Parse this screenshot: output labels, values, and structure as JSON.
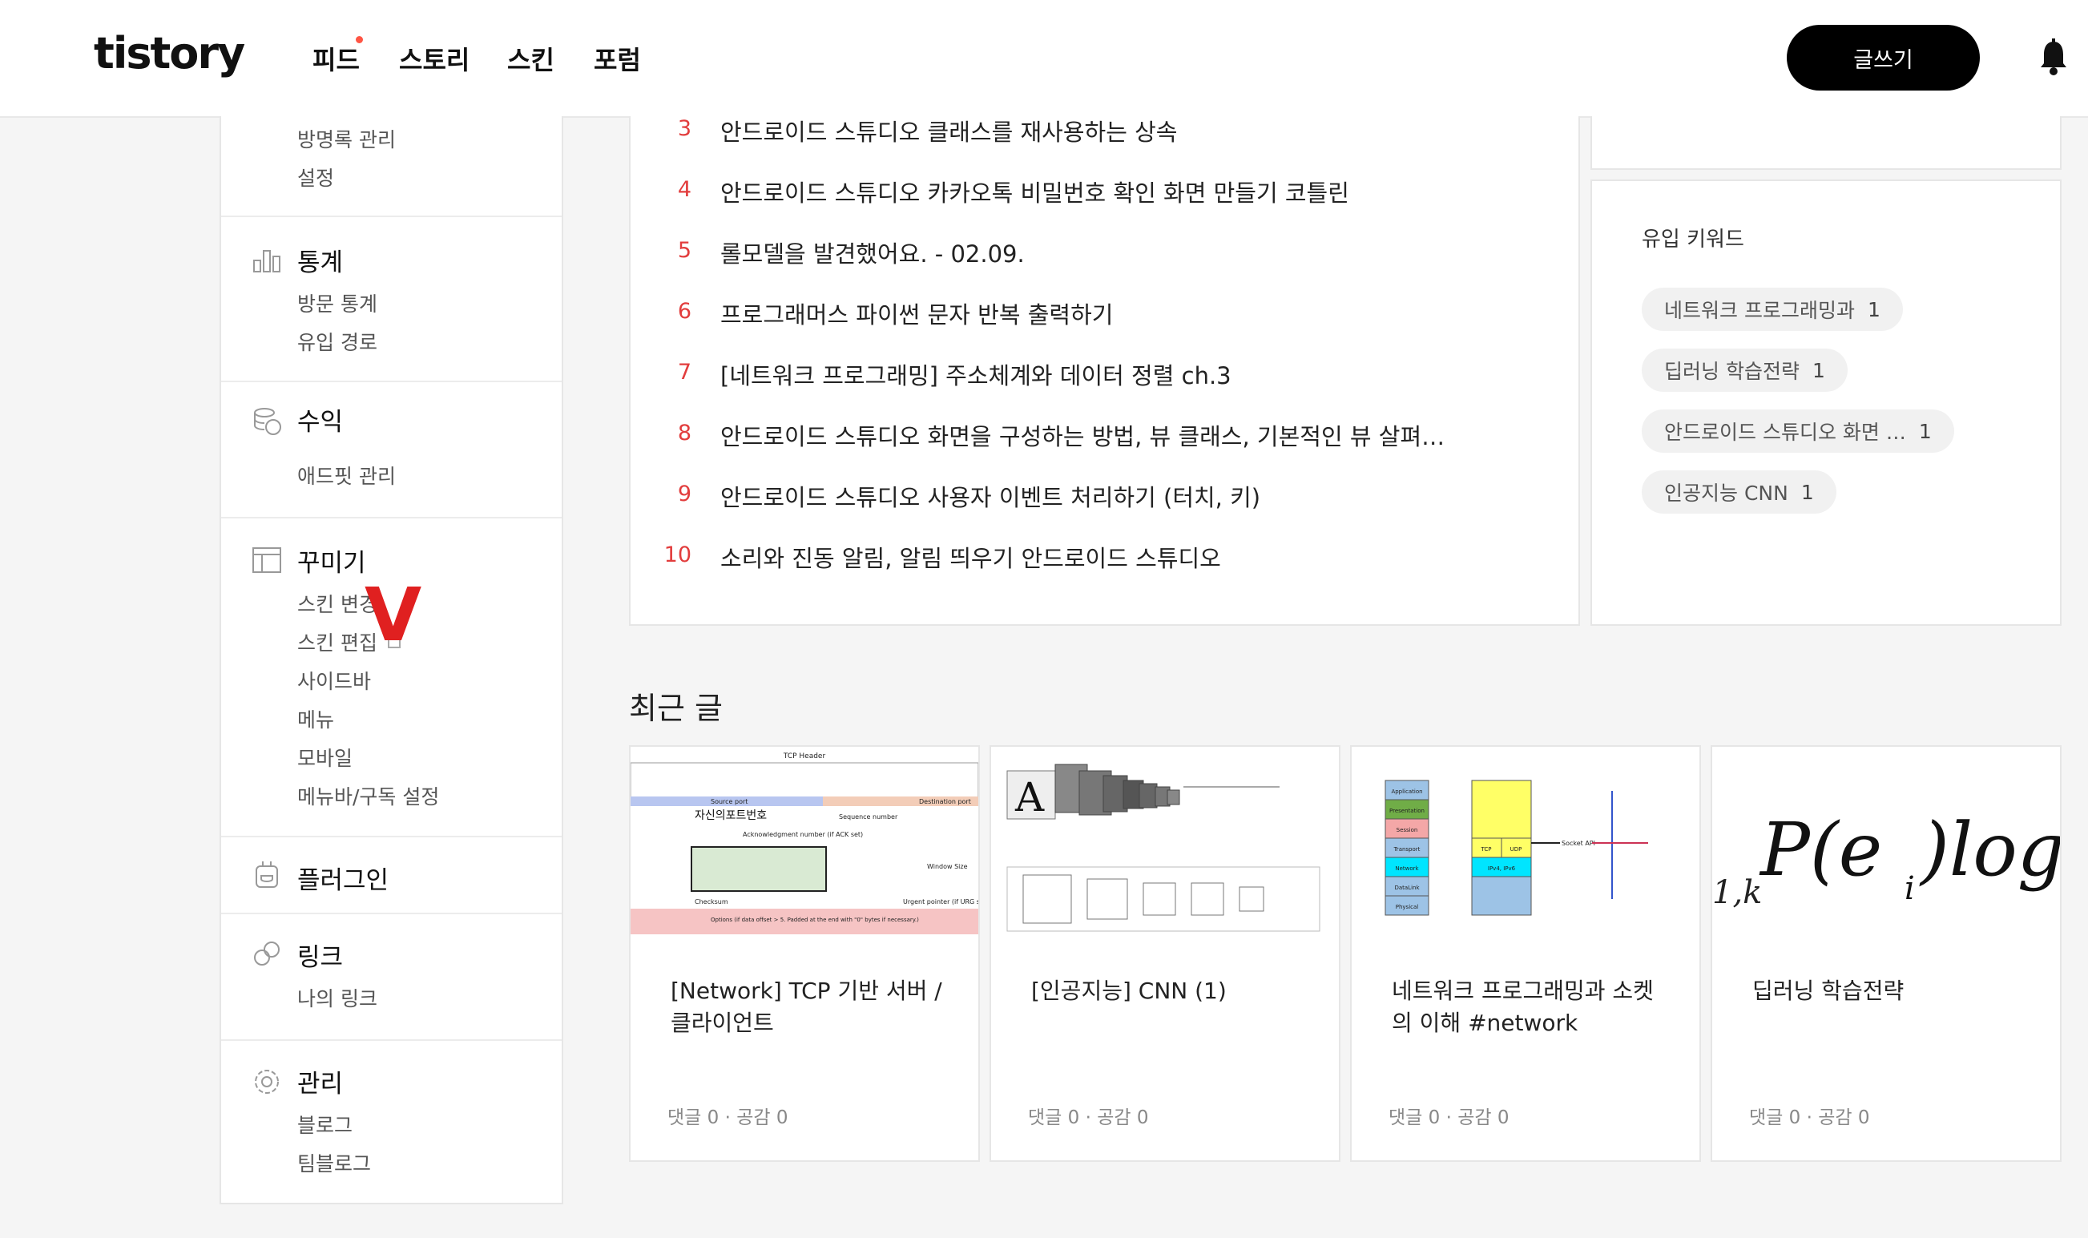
{
  "header": {
    "logo": "tistory",
    "nav": [
      "피드",
      "스토리",
      "스킨",
      "포럼"
    ],
    "write_label": "글쓰기"
  },
  "sidebar": {
    "top_items": [
      "방명록 관리",
      "설정"
    ],
    "sections": [
      {
        "title": "통계",
        "icon": "bar-chart-icon",
        "items": [
          "방문 통계",
          "유입 경로"
        ]
      },
      {
        "title": "수익",
        "icon": "coins-icon",
        "items": [
          "애드핏 관리"
        ]
      },
      {
        "title": "꾸미기",
        "icon": "layout-icon",
        "items": [
          "스킨 변경",
          "스킨 편집",
          "사이드바",
          "메뉴",
          "모바일",
          "메뉴바/구독 설정"
        ]
      },
      {
        "title": "플러그인",
        "icon": "plug-icon",
        "items": []
      },
      {
        "title": "링크",
        "icon": "link-icon",
        "items": [
          "나의 링크"
        ]
      },
      {
        "title": "관리",
        "icon": "gear-icon",
        "items": [
          "블로그",
          "팀블로그"
        ]
      }
    ],
    "annotation_mark": "V"
  },
  "popular": {
    "items": [
      {
        "rank": "3",
        "title": "안드로이드 스튜디오 클래스를 재사용하는 상속"
      },
      {
        "rank": "4",
        "title": "안드로이드 스튜디오 카카오톡 비밀번호 확인 화면 만들기 코틀린"
      },
      {
        "rank": "5",
        "title": "롤모델을 발견했어요. - 02.09."
      },
      {
        "rank": "6",
        "title": "프로그래머스 파이썬 문자 반복 출력하기"
      },
      {
        "rank": "7",
        "title": "[네트워크 프로그래밍] 주소체계와 데이터 정렬 ch.3"
      },
      {
        "rank": "8",
        "title": "안드로이드 스튜디오 화면을 구성하는 방법, 뷰 클래스, 기본적인 뷰 살펴…"
      },
      {
        "rank": "9",
        "title": "안드로이드 스튜디오 사용자 이벤트 처리하기 (터치, 키)"
      },
      {
        "rank": "10",
        "title": "소리와 진동 알림, 알림 띄우기 안드로이드 스튜디오"
      }
    ]
  },
  "keywords": {
    "title": "유입 키워드",
    "items": [
      {
        "label": "네트워크 프로그래밍과",
        "count": "1"
      },
      {
        "label": "딥러닝 학습전략",
        "count": "1"
      },
      {
        "label": "안드로이드 스튜디오 화면 …",
        "count": "1"
      },
      {
        "label": "인공지능 CNN",
        "count": "1"
      }
    ]
  },
  "recent": {
    "title": "최근 글",
    "posts": [
      {
        "title": "[Network] TCP 기반 서버 / 클라이언트",
        "meta": "댓글 0 · 공감 0",
        "thumb_text": [
          "TCP Header",
          "자신의포트번호",
          "Source port",
          "Destination port",
          "Sequence number",
          "Acknowledgment number (if ACK set)",
          "Checksum",
          "Window Size",
          "Urgent pointer (if URG set)",
          "Options (if data offset > 5. Padded at the end with \"0\" bytes if necessary.)"
        ]
      },
      {
        "title": "[인공지능] CNN (1)",
        "meta": "댓글 0 · 공감 0",
        "thumb_text": [
          "A"
        ]
      },
      {
        "title": "네트워크 프로그래밍과 소켓의 이해 #network",
        "meta": "댓글 0 · 공감 0",
        "thumb_text": [
          "Application",
          "Presentation",
          "Session",
          "Transport",
          "Network",
          "DataLink",
          "Physical",
          "TCP",
          "UDP",
          "IPv4, IPv6",
          "Socket API"
        ]
      },
      {
        "title": "딥러닝 학습전략",
        "meta": "댓글 0 · 공감 0",
        "thumb_text": [
          "1,k",
          "P(e",
          "i",
          ")logI"
        ]
      }
    ]
  },
  "colors": {
    "accent": "#e23d3d",
    "button": "#000000",
    "background": "#f5f5f5"
  }
}
